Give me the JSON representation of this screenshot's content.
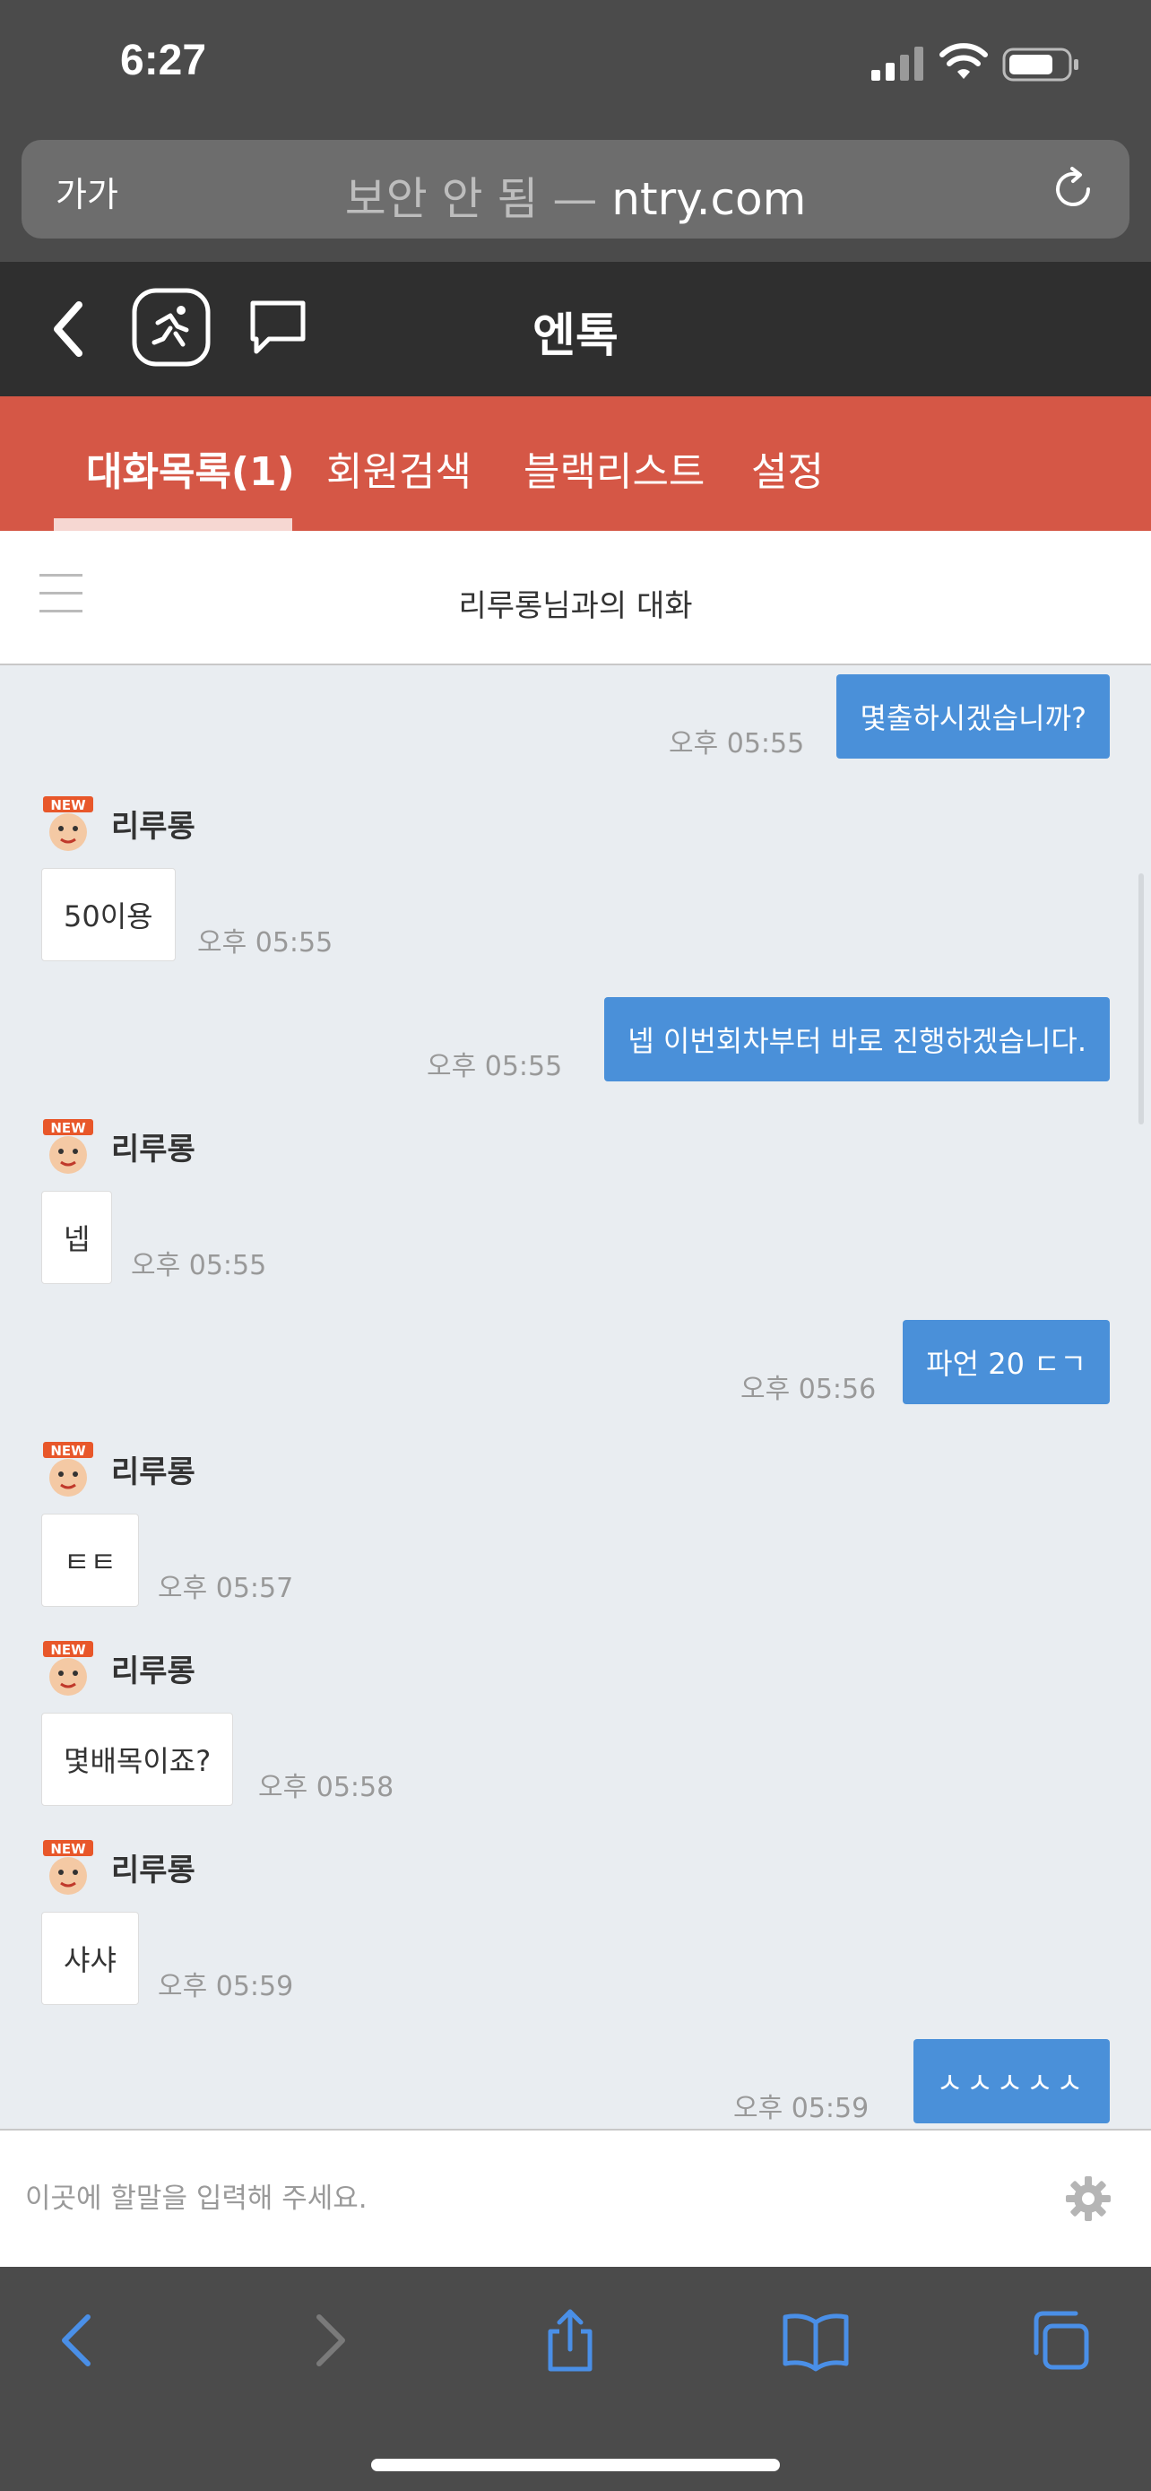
{
  "status_bar": {
    "time": "6:27"
  },
  "browser": {
    "text_size_button": "가가",
    "url_security": "보안 안 됨 —",
    "url_domain": "ntry.com"
  },
  "app": {
    "title": "엔톡"
  },
  "tabs": [
    {
      "label": "대화목록(1)",
      "active": true
    },
    {
      "label": "회원검색",
      "active": false
    },
    {
      "label": "블랙리스트",
      "active": false
    },
    {
      "label": "설정",
      "active": false
    }
  ],
  "conversation": {
    "title": "리루롱님과의 대화"
  },
  "messages": [
    {
      "side": "right",
      "text": "몇출하시겠습니까?",
      "time": "오후 05:55"
    },
    {
      "side": "left",
      "sender": "리루롱",
      "text": "50이용",
      "time": "오후 05:55"
    },
    {
      "side": "right",
      "text": "넵 이번회차부터 바로 진행하겠습니다.",
      "time": "오후 05:55"
    },
    {
      "side": "left",
      "sender": "리루롱",
      "text": "넵",
      "time": "오후 05:55"
    },
    {
      "side": "right",
      "text": "파언 20 ㄷㄱ",
      "time": "오후 05:56"
    },
    {
      "side": "left",
      "sender": "리루롱",
      "text": "ㅌㅌ",
      "time": "오후 05:57"
    },
    {
      "side": "left",
      "sender": "리루롱",
      "text": "몇배목이죠?",
      "time": "오후 05:58"
    },
    {
      "side": "left",
      "sender": "리루롱",
      "text": "샤샤",
      "time": "오후 05:59"
    },
    {
      "side": "right",
      "text": "ㅅㅅㅅㅅㅅ",
      "time": "오후 05:59"
    }
  ],
  "avatar_badge": "NEW",
  "input": {
    "placeholder": "이곳에 할말을 입력해 주세요."
  },
  "colors": {
    "header_bg": "#2f2f2f",
    "tab_bar_bg": "#d55746",
    "sent_bubble": "#4a90d9",
    "chat_bg": "#e9edf1"
  }
}
